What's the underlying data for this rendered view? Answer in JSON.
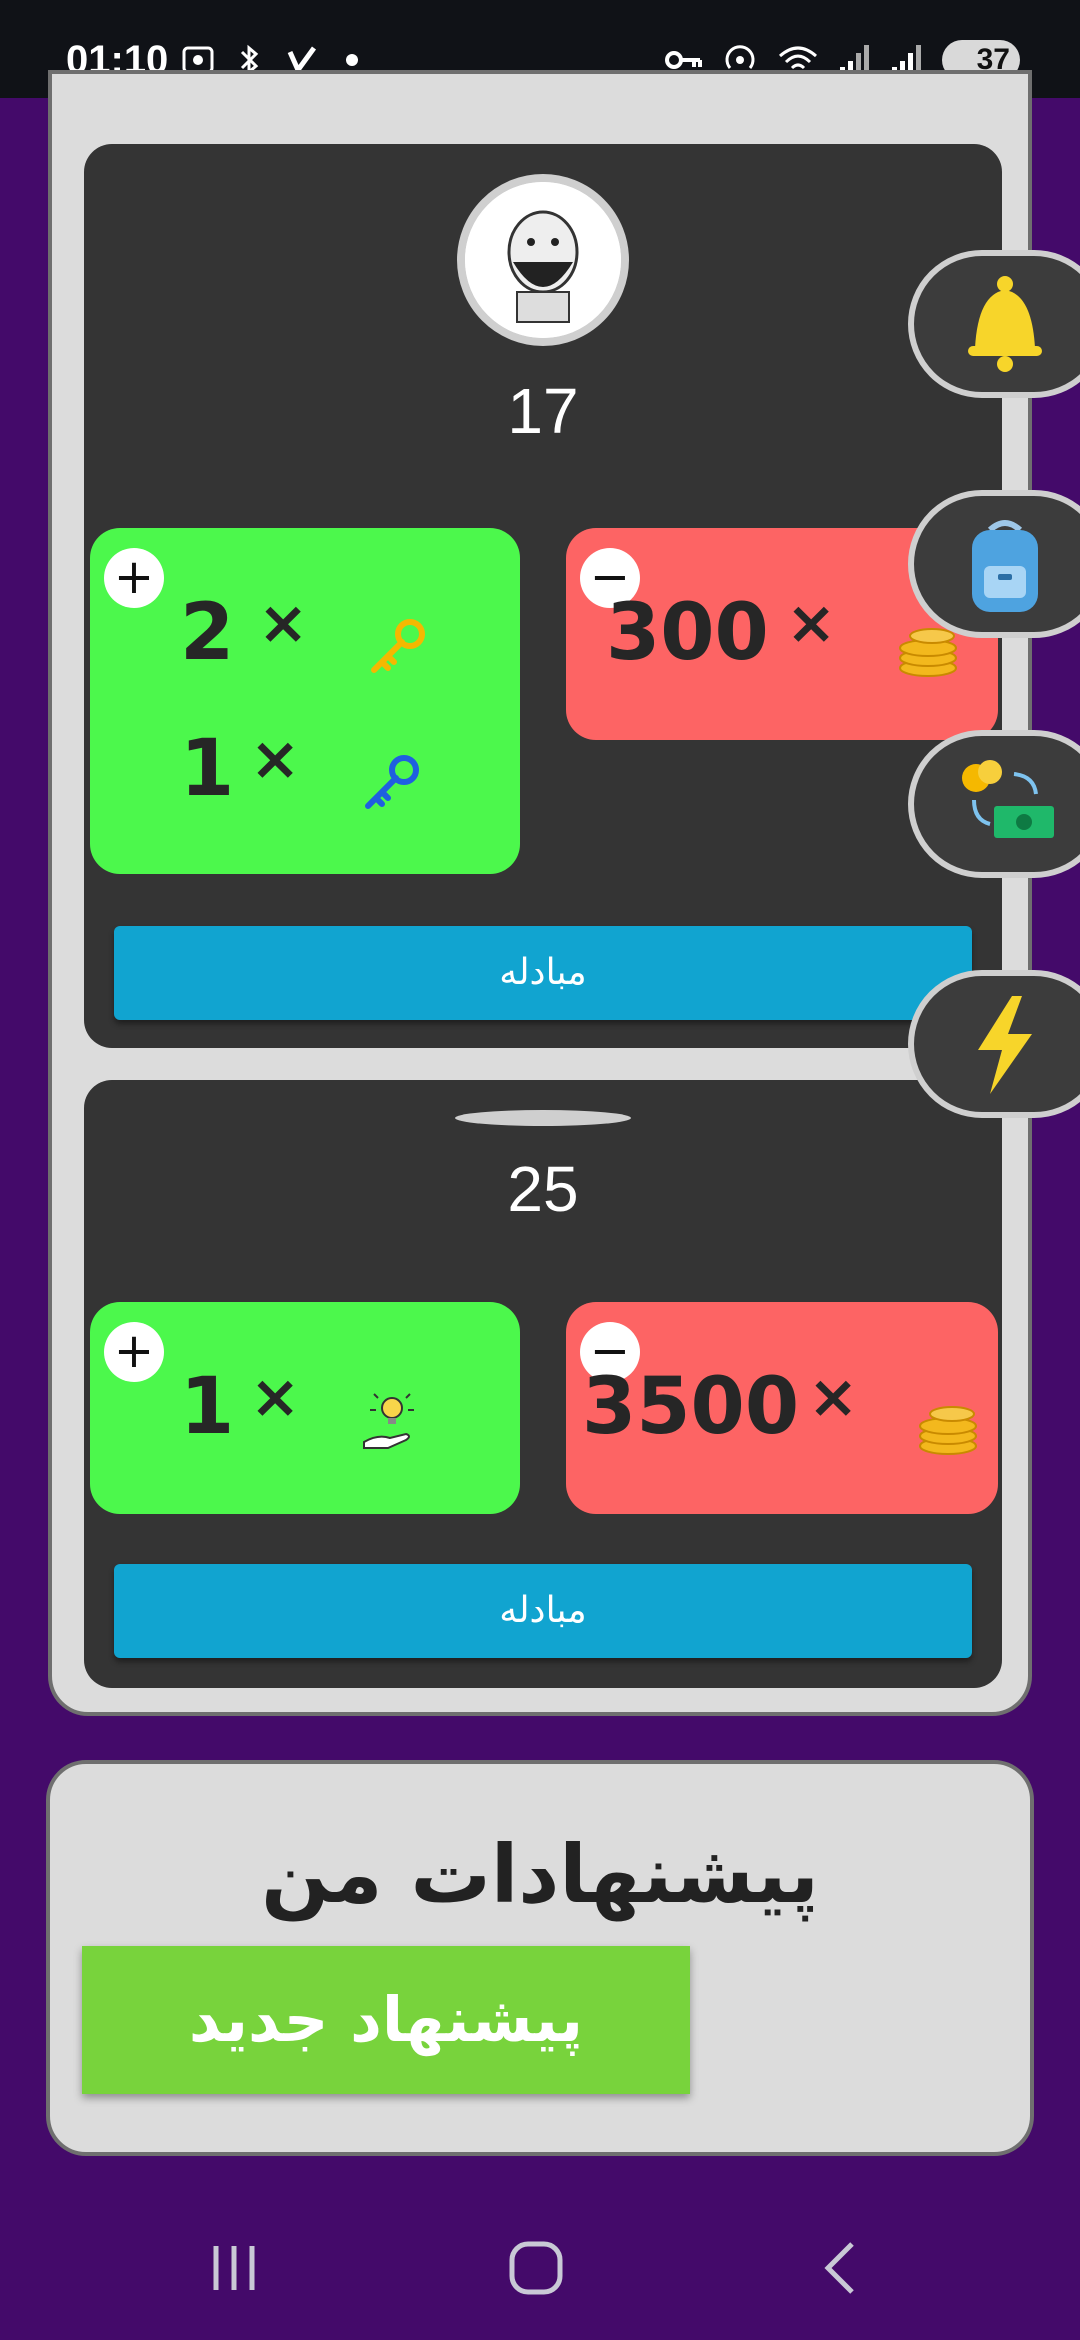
{
  "status_bar": {
    "time": "01:10",
    "battery": "37",
    "icons_left": [
      "screenshot-icon",
      "bluetooth-icon",
      "app-v-icon",
      "dot-icon"
    ],
    "icons_right": [
      "vpn-key-icon",
      "hotspot-icon",
      "wifi-icon",
      "signal-icon",
      "signal-icon-2"
    ]
  },
  "offers": [
    {
      "score": "17",
      "give": [
        {
          "qty": "2",
          "times": "×",
          "icon": "gold-key-icon"
        },
        {
          "qty": "1",
          "times": "×",
          "icon": "blue-key-icon"
        }
      ],
      "receive": [
        {
          "qty": "300",
          "times": "×",
          "icon": "coins-icon"
        }
      ],
      "plus": "+",
      "minus": "−",
      "button": "مبادله"
    },
    {
      "score": "25",
      "give": [
        {
          "qty": "1",
          "times": "×",
          "icon": "hint-lightbulb-icon"
        }
      ],
      "receive": [
        {
          "qty": "3500",
          "times": "×",
          "icon": "coins-icon"
        }
      ],
      "plus": "+",
      "minus": "−",
      "button": "مبادله"
    }
  ],
  "side_tabs": [
    "bell-icon",
    "backpack-icon",
    "exchange-money-icon",
    "lightning-icon"
  ],
  "my_offers": {
    "title": "پیشنهادات من",
    "new_button": "پیشنهاد جدید"
  },
  "colors": {
    "background": "#440a6a",
    "give_box": "#4cf84c",
    "receive_box": "#fd6464",
    "exchange_button": "#11a4d0",
    "new_offer_button": "#78d33c"
  }
}
